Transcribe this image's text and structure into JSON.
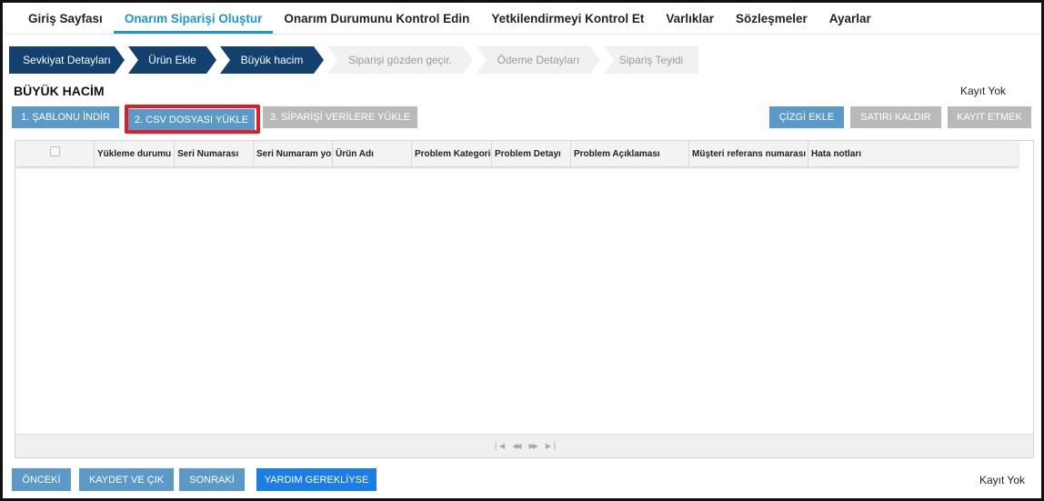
{
  "nav": {
    "items": [
      {
        "label": "Giriş Sayfası"
      },
      {
        "label": "Onarım Siparişi Oluştur"
      },
      {
        "label": "Onarım Durumunu Kontrol Edin"
      },
      {
        "label": "Yetkilendirmeyi Kontrol Et"
      },
      {
        "label": "Varlıklar"
      },
      {
        "label": "Sözleşmeler"
      },
      {
        "label": "Ayarlar"
      }
    ],
    "active_index": 1
  },
  "stepper": {
    "steps": [
      {
        "label": "Sevkiyat Detayları",
        "state": "done"
      },
      {
        "label": "Ürün Ekle",
        "state": "done"
      },
      {
        "label": "Büyük hacim",
        "state": "done"
      },
      {
        "label": "Siparişi gözden geçir.",
        "state": "todo"
      },
      {
        "label": "Ödeme Detayları",
        "state": "todo"
      },
      {
        "label": "Sipariş Teyidi",
        "state": "todo"
      }
    ]
  },
  "section": {
    "title": "BÜYÜK HACİM",
    "record_status": "Kayıt Yok"
  },
  "toolbar": {
    "download_template": "1. ŞABLONU İNDİR",
    "upload_csv": "2. CSV DOSYASI YÜKLE",
    "upload_order": "3. SİPARİŞİ VERİLERE YÜKLE",
    "add_line": "ÇİZGİ EKLE",
    "remove_row": "SATIRI KALDIR",
    "save_record": "KAYIT ETMEK"
  },
  "grid": {
    "columns": [
      "Yükleme durumu b",
      "Seri Numarası",
      "Seri Numaram yok",
      "Ürün Adı",
      "Problem Kategoris",
      "Problem Detayı",
      "Problem Açıklaması",
      "Müşteri referans numarası",
      "Hata notları"
    ],
    "pager": {
      "first_icon": "first-page-icon",
      "prev_icon": "prev-page-icon",
      "next_icon": "next-page-icon",
      "last_icon": "last-page-icon"
    }
  },
  "footer": {
    "prev": "ÖNCEKİ",
    "save_exit": "KAYDET VE ÇIK",
    "next": "SONRAKİ",
    "help": "YARDIM GEREKLİYSE",
    "record_status": "Kayıt Yok"
  },
  "colors": {
    "accent": "#1a95d6",
    "step_done": "#12406f",
    "button_blue": "#5b9ac8",
    "button_gray": "#b9b9b9",
    "button_help": "#1a7ee6",
    "highlight_border": "#e31b23"
  }
}
